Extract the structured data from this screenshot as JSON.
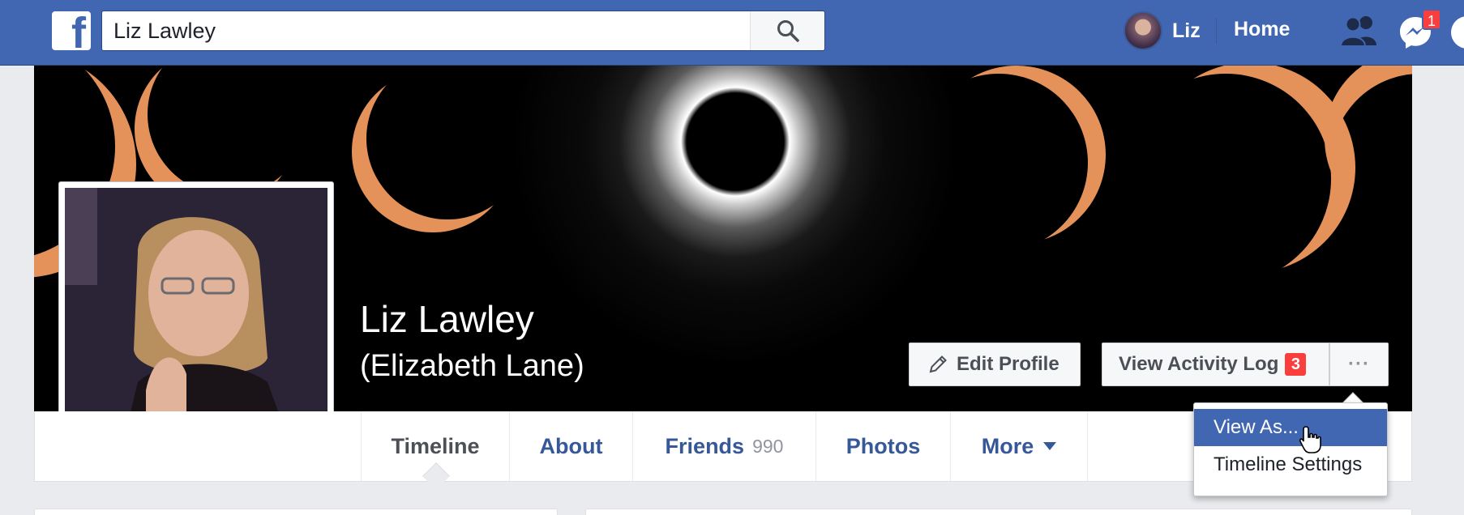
{
  "topbar": {
    "search_value": "Liz Lawley",
    "user_name": "Liz",
    "home_label": "Home",
    "messages_badge": "1"
  },
  "profile": {
    "name": "Liz Lawley",
    "alternate_name": "(Elizabeth Lane)",
    "edit_profile_label": "Edit Profile",
    "activity_log_label": "View Activity Log",
    "activity_log_badge": "3",
    "more_options_label": "···"
  },
  "tabs": [
    {
      "label": "Timeline"
    },
    {
      "label": "About"
    },
    {
      "label": "Friends",
      "count": "990"
    },
    {
      "label": "Photos"
    },
    {
      "label": "More"
    }
  ],
  "dropdown": {
    "items": [
      {
        "label": "View As..."
      },
      {
        "label": "Timeline Settings"
      }
    ]
  },
  "colors": {
    "brand": "#4267b2",
    "link": "#365899",
    "badge": "#fa3e3e"
  }
}
